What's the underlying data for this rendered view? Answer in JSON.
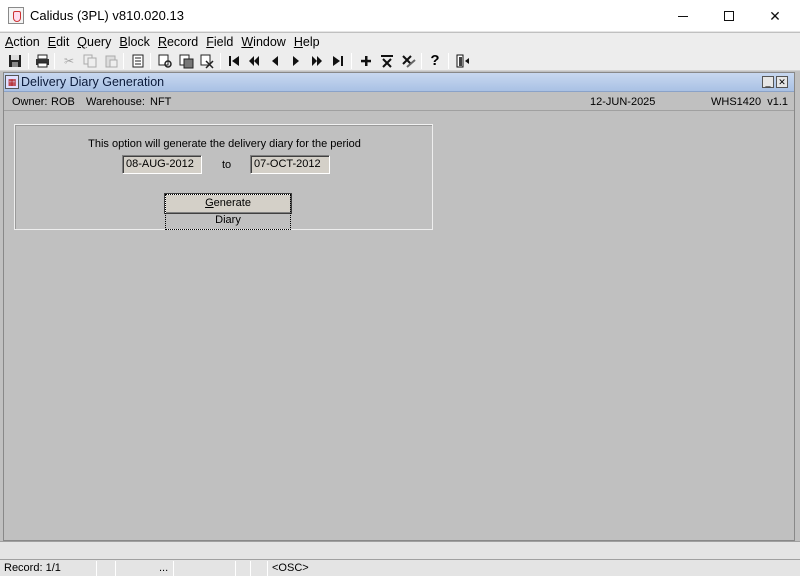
{
  "window": {
    "title": "Calidus (3PL) v810.020.13",
    "minimize_icon": "minimize-icon",
    "maximize_icon": "maximize-icon",
    "close_icon": "close-icon"
  },
  "menubar": {
    "items": [
      {
        "label": "Action",
        "mnemonic": "A"
      },
      {
        "label": "Edit",
        "mnemonic": "E"
      },
      {
        "label": "Query",
        "mnemonic": "Q"
      },
      {
        "label": "Block",
        "mnemonic": "B"
      },
      {
        "label": "Record",
        "mnemonic": "R"
      },
      {
        "label": "Field",
        "mnemonic": "F"
      },
      {
        "label": "Window",
        "mnemonic": "W"
      },
      {
        "label": "Help",
        "mnemonic": "H"
      }
    ]
  },
  "toolbar": {
    "icons": [
      "save-icon",
      "print-icon",
      "cut-icon",
      "copy-icon",
      "paste-icon",
      "list-icon",
      "enter-query-icon",
      "execute-query-icon",
      "cancel-query-icon",
      "first-record-icon",
      "previous-block-icon",
      "previous-record-icon",
      "next-record-icon",
      "next-block-icon",
      "last-record-icon",
      "insert-record-icon",
      "delete-record-icon",
      "clear-record-icon",
      "help-icon",
      "exit-icon"
    ]
  },
  "form": {
    "title": "Delivery Diary Generation",
    "owner_label": "Owner:",
    "owner_value": "ROB",
    "warehouse_label": "Warehouse:",
    "warehouse_value": "NFT",
    "date": "12-JUN-2025",
    "form_id": "WHS1420  v1.1",
    "message": "This option will generate the delivery diary for the period",
    "from_date": "08-AUG-2012",
    "to_label": "to",
    "to_date": "07-OCT-2012",
    "generate_button": "Generate Diary"
  },
  "status": {
    "record": "Record: 1/1",
    "ellipsis": "...",
    "mode": "<OSC>"
  },
  "colors": {
    "background": "#c0c0c0",
    "frame_title": "#a9c1e4"
  }
}
